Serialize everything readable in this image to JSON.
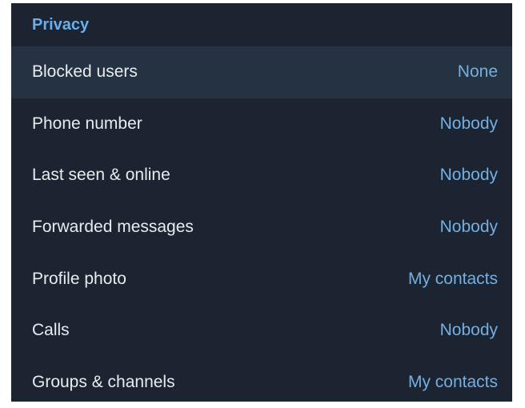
{
  "section": {
    "title": "Privacy"
  },
  "rows": [
    {
      "label": "Blocked users",
      "value": "None"
    },
    {
      "label": "Phone number",
      "value": "Nobody"
    },
    {
      "label": "Last seen & online",
      "value": "Nobody"
    },
    {
      "label": "Forwarded messages",
      "value": "Nobody"
    },
    {
      "label": "Profile photo",
      "value": "My contacts"
    },
    {
      "label": "Calls",
      "value": "Nobody"
    },
    {
      "label": "Groups & channels",
      "value": "My contacts"
    }
  ],
  "colors": {
    "background": "#1b2430",
    "row_hover": "#253242",
    "accent": "#6aaee9",
    "text": "#e8ecf0"
  }
}
